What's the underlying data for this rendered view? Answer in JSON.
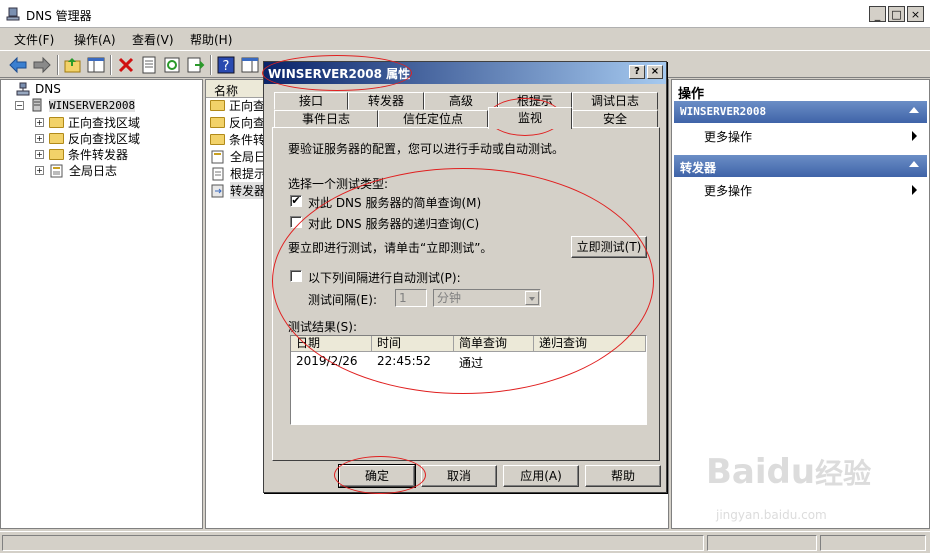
{
  "window": {
    "title": "DNS 管理器",
    "controls": [
      "_",
      "□",
      "×"
    ]
  },
  "menu": {
    "items": [
      "文件(F)",
      "操作(A)",
      "查看(V)",
      "帮助(H)"
    ]
  },
  "tree": {
    "root": "DNS",
    "server": "WINSERVER2008",
    "children": [
      "正向查找区域",
      "反向查找区域",
      "条件转发器",
      "全局日志"
    ],
    "expanders": [
      "−",
      "−",
      "+",
      "+",
      "+",
      "+"
    ]
  },
  "list": {
    "header": "名称",
    "rows": [
      "正向查",
      "反向查",
      "条件转",
      "全局日",
      "根提示",
      "转发器"
    ]
  },
  "actions": {
    "title": "操作",
    "sections": [
      {
        "name": "WINSERVER2008",
        "link": "更多操作"
      },
      {
        "name": "转发器",
        "link": "更多操作"
      }
    ]
  },
  "dialog": {
    "title": "WINSERVER2008 属性",
    "title_buttons": [
      "?",
      "×"
    ],
    "tabs_row1": [
      "接口",
      "转发器",
      "高级",
      "根提示",
      "调试日志"
    ],
    "tabs_row2": [
      "事件日志",
      "信任定位点",
      "监视",
      "安全"
    ],
    "active_tab": "监视",
    "intro": "要验证服务器的配置，您可以进行手动或自动测试。",
    "test_type_label": "选择一个测试类型:",
    "simple_query": {
      "label": "对此 DNS 服务器的简单查询(M)",
      "checked": true,
      "mark": "✔"
    },
    "recursive_query": {
      "label": "对此 DNS 服务器的递归查询(C)",
      "checked": false
    },
    "run_hint": "要立即进行测试，请单击“立即测试”。",
    "test_now_button": "立即测试(T)",
    "auto_test": {
      "label": "以下列间隔进行自动测试(P):",
      "checked": false
    },
    "interval_label": "测试间隔(E):",
    "interval_value": "1",
    "interval_unit": "分钟",
    "results_label": "测试结果(S):",
    "results_columns": [
      "日期",
      "时间",
      "简单查询",
      "递归查询"
    ],
    "results_rows": [
      {
        "date": "2019/2/26",
        "time": "22:45:52",
        "simple": "通过",
        "recursive": ""
      }
    ],
    "buttons": {
      "ok": "确定",
      "cancel": "取消",
      "apply": "应用(A)",
      "help": "帮助"
    }
  },
  "watermark": {
    "brand": "Bai",
    "paw": "du",
    "cn": "经验",
    "url": "jingyan.baidu.com"
  },
  "colors": {
    "annotation": "#e02020",
    "dialog_title_start": "#0a246a",
    "action_header": "#3f63a8"
  }
}
